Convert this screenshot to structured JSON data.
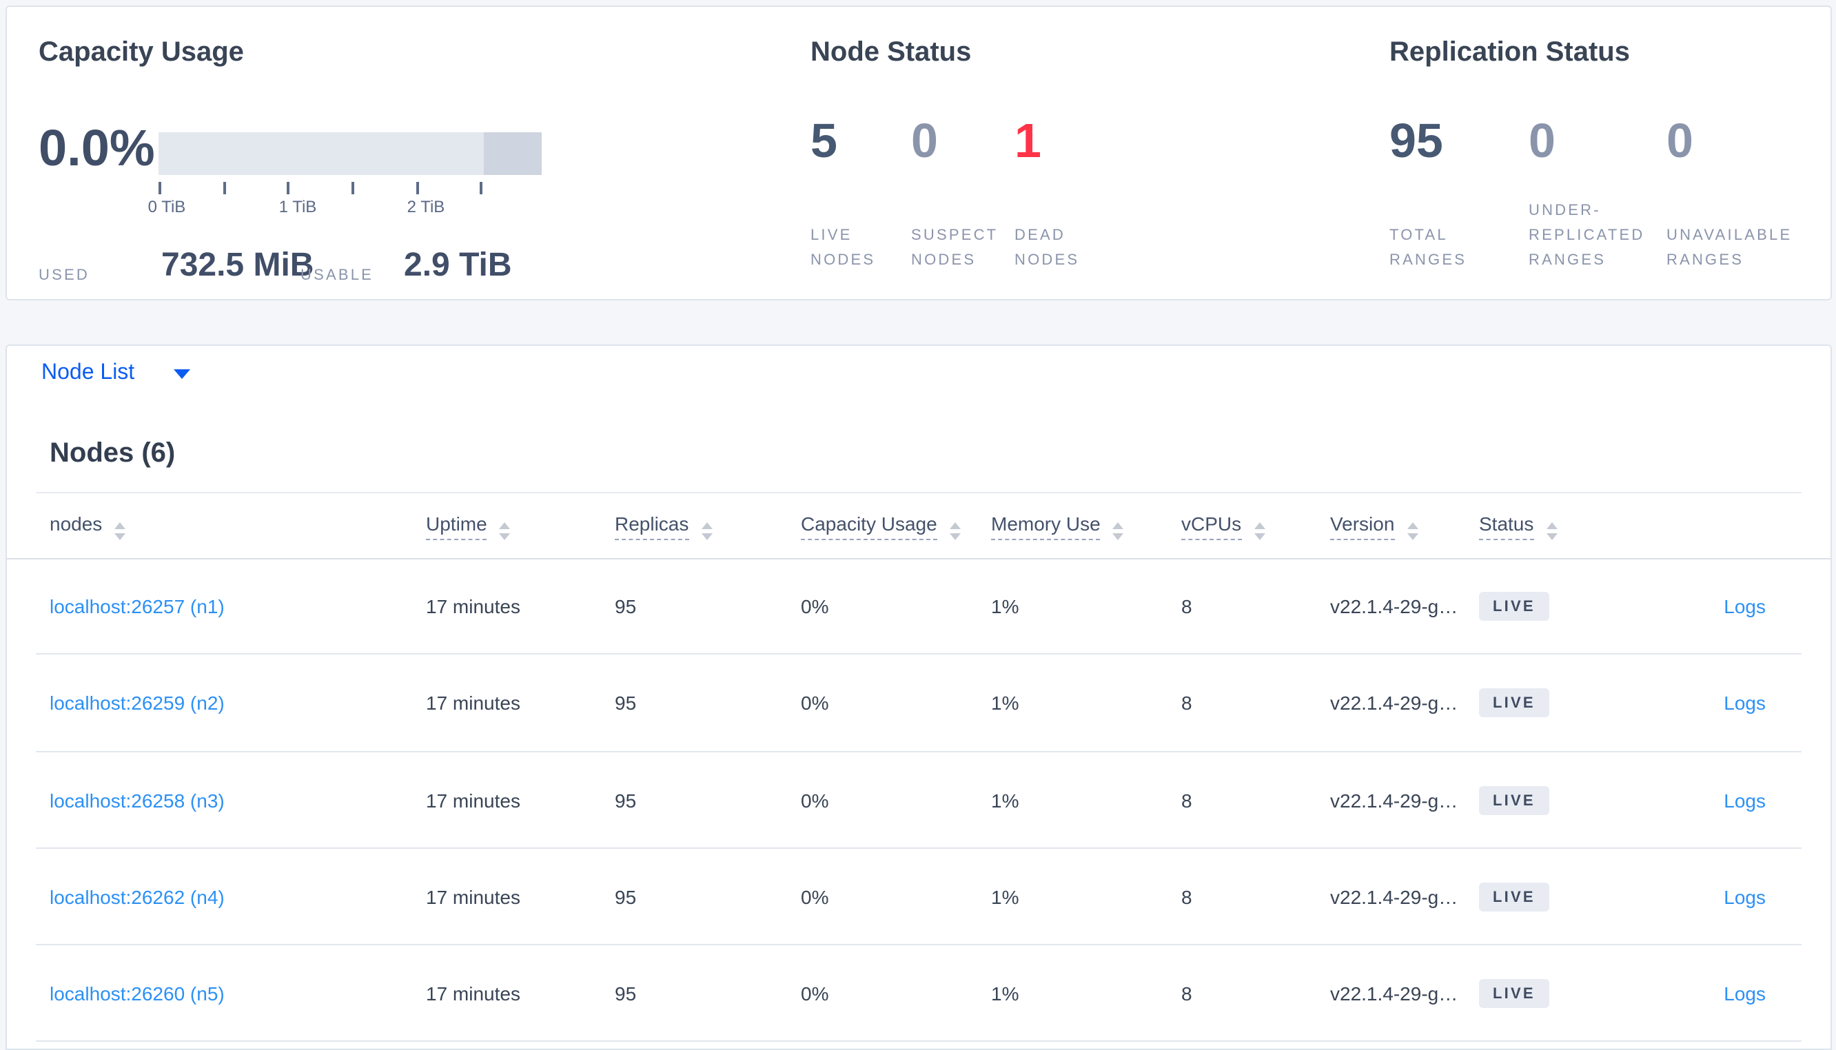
{
  "summary": {
    "capacity": {
      "title": "Capacity Usage",
      "percent": "0.0%",
      "tick_labels": [
        "0 TiB",
        "1 TiB",
        "2 TiB"
      ],
      "used_label": "USED",
      "used_value": "732.5 MiB",
      "usable_label": "USABLE",
      "usable_value": "2.9 TiB"
    },
    "node_status": {
      "title": "Node Status",
      "stats": [
        {
          "value": "5",
          "label": "LIVE NODES",
          "color": "#475872"
        },
        {
          "value": "0",
          "label": "SUSPECT NODES",
          "color": "#8a94ab"
        },
        {
          "value": "1",
          "label": "DEAD NODES",
          "color": "#ff3347"
        }
      ]
    },
    "replication_status": {
      "title": "Replication Status",
      "stats": [
        {
          "value": "95",
          "label": "TOTAL RANGES",
          "color": "#475872"
        },
        {
          "value": "0",
          "label": "UNDER-REPLICATED RANGES",
          "color": "#8a94ab"
        },
        {
          "value": "0",
          "label": "UNAVAILABLE RANGES",
          "color": "#8a94ab"
        }
      ]
    }
  },
  "view_selector": {
    "label": "Node List"
  },
  "nodes_table": {
    "title": "Nodes (6)",
    "columns": [
      "nodes",
      "Uptime",
      "Replicas",
      "Capacity Usage",
      "Memory Use",
      "vCPUs",
      "Version",
      "Status"
    ],
    "rows": [
      {
        "node": "localhost:26257 (n1)",
        "uptime": "17 minutes",
        "replicas": "95",
        "capacity_usage": "0%",
        "memory_use": "1%",
        "vcpus": "8",
        "version": "v22.1.4-29-g…",
        "status": "LIVE",
        "logs": "Logs"
      },
      {
        "node": "localhost:26259 (n2)",
        "uptime": "17 minutes",
        "replicas": "95",
        "capacity_usage": "0%",
        "memory_use": "1%",
        "vcpus": "8",
        "version": "v22.1.4-29-g…",
        "status": "LIVE",
        "logs": "Logs"
      },
      {
        "node": "localhost:26258 (n3)",
        "uptime": "17 minutes",
        "replicas": "95",
        "capacity_usage": "0%",
        "memory_use": "1%",
        "vcpus": "8",
        "version": "v22.1.4-29-g…",
        "status": "LIVE",
        "logs": "Logs"
      },
      {
        "node": "localhost:26262 (n4)",
        "uptime": "17 minutes",
        "replicas": "95",
        "capacity_usage": "0%",
        "memory_use": "1%",
        "vcpus": "8",
        "version": "v22.1.4-29-g…",
        "status": "LIVE",
        "logs": "Logs"
      },
      {
        "node": "localhost:26260 (n5)",
        "uptime": "17 minutes",
        "replicas": "95",
        "capacity_usage": "0%",
        "memory_use": "1%",
        "vcpus": "8",
        "version": "v22.1.4-29-g…",
        "status": "LIVE",
        "logs": "Logs"
      }
    ]
  },
  "colors": {
    "accent_blue": "#0b5cf2",
    "link_blue": "#2b90f5",
    "dead_red": "#ff3347",
    "dark_text": "#394455",
    "muted_text": "#8a94ab"
  }
}
